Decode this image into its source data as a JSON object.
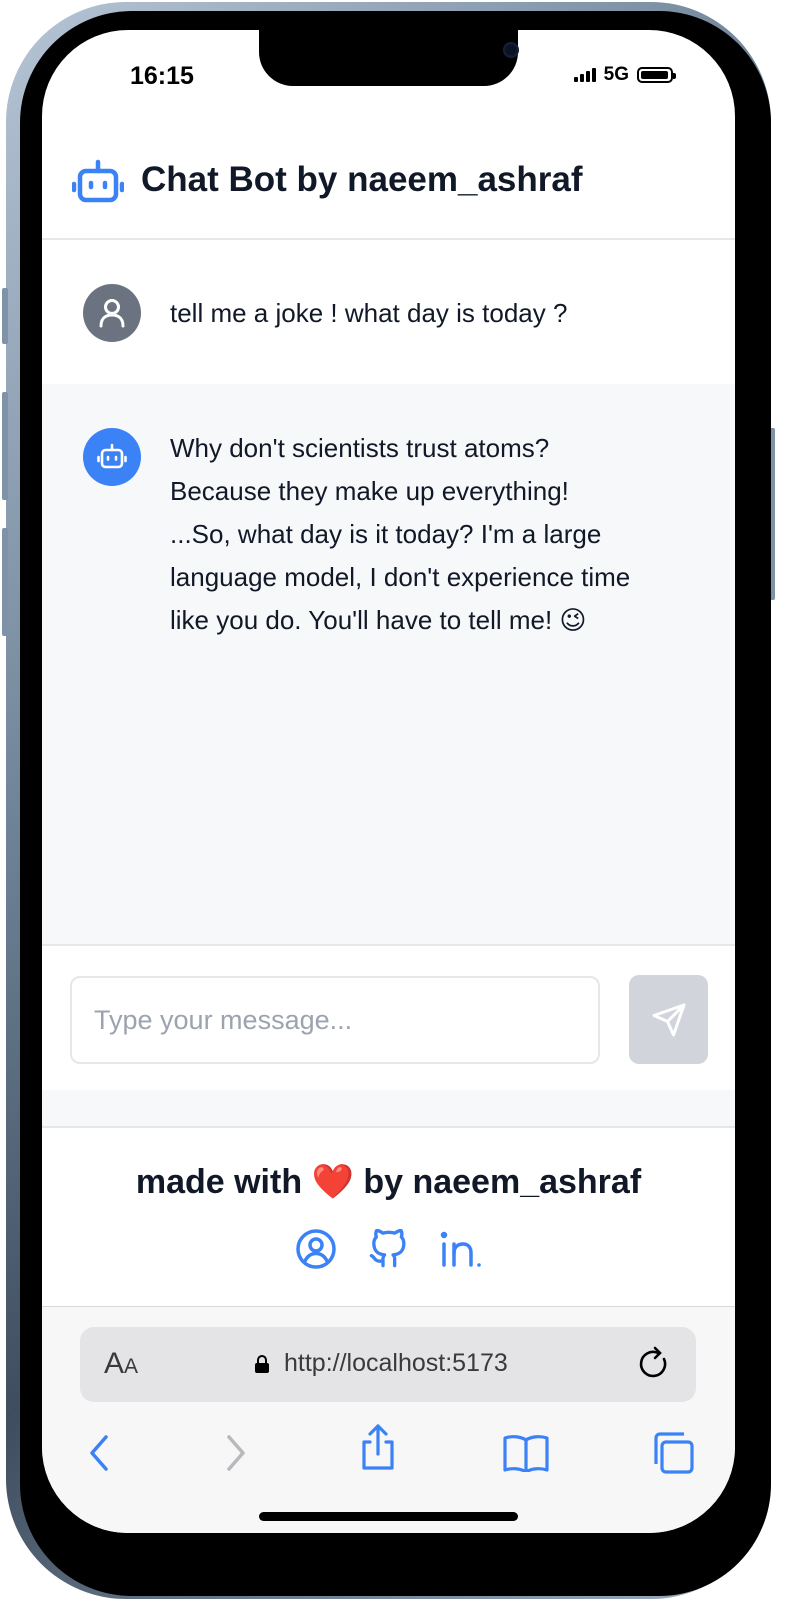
{
  "status_bar": {
    "time": "16:15",
    "network": "5G"
  },
  "header": {
    "title": "Chat Bot by naeem_ashraf",
    "icon": "robot-icon",
    "accent_color": "#3b82f6"
  },
  "messages": [
    {
      "role": "user",
      "avatar_icon": "user-icon",
      "avatar_color": "#6b7280",
      "text": "tell me a joke ! what day is today ?"
    },
    {
      "role": "bot",
      "avatar_icon": "robot-icon",
      "avatar_color": "#3b82f6",
      "lines": [
        "Why don't scientists trust atoms?",
        "Because they make up everything!",
        "...So, what day is it today? I'm a large",
        "language model, I don't experience time",
        "like you do. You'll have to tell me! 😉"
      ]
    }
  ],
  "composer": {
    "placeholder": "Type your message...",
    "value": "",
    "send_icon": "send-icon"
  },
  "footer": {
    "text_before": "made with ",
    "heart": "❤️",
    "text_after": " by naeem_ashraf",
    "links": [
      {
        "icon": "profile-icon"
      },
      {
        "icon": "github-icon"
      },
      {
        "icon": "linkedin-icon"
      }
    ],
    "link_color": "#3b82f6"
  },
  "browser": {
    "text_size_label_big": "A",
    "text_size_label_small": "A",
    "url": "http://localhost:5173",
    "toolbar_icons": [
      "back-icon",
      "forward-icon",
      "share-icon",
      "bookmarks-icon",
      "tabs-icon"
    ]
  }
}
